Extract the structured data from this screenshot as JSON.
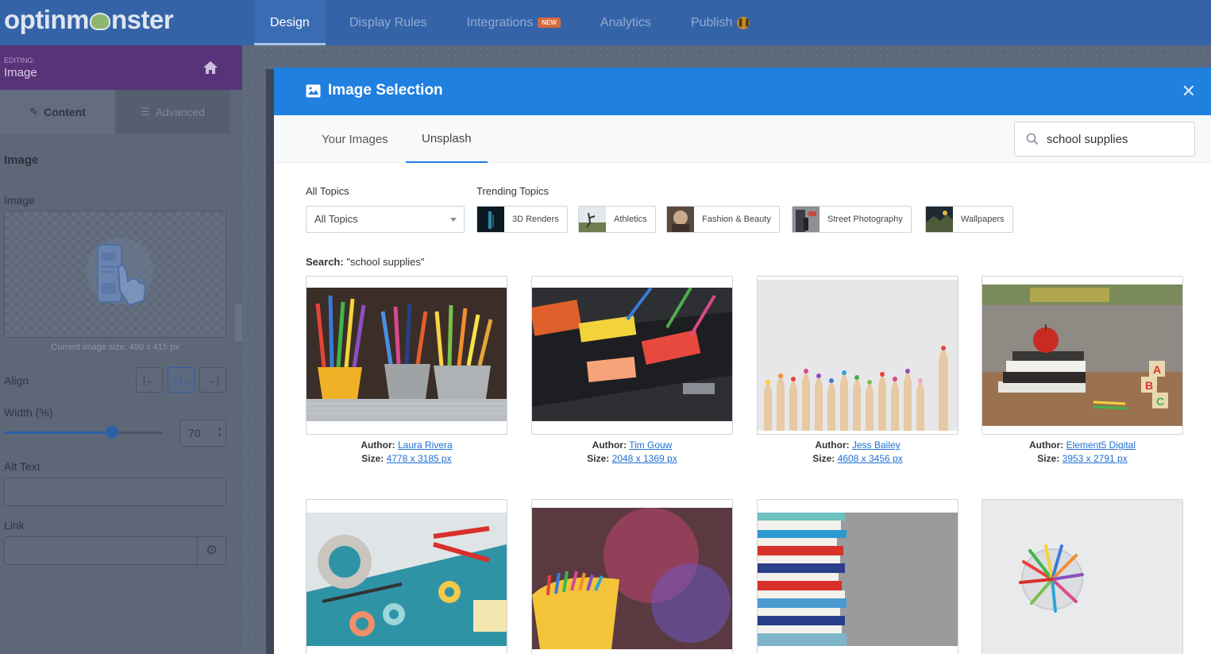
{
  "app": {
    "logo_text_left": "optinm",
    "logo_text_right": "nster",
    "nav": [
      {
        "label": "Design"
      },
      {
        "label": "Display Rules"
      },
      {
        "label": "Integrations",
        "badge": "NEW"
      },
      {
        "label": "Analytics"
      },
      {
        "label": "Publish",
        "badge": "!!"
      }
    ]
  },
  "editor": {
    "editing_label": "EDITING:",
    "editing_name": "Image",
    "tabs": [
      {
        "label": "Content"
      },
      {
        "label": "Advanced"
      }
    ],
    "section_title": "Image",
    "image_label": "Image",
    "current_size": "Current image size: 490 x 415 px",
    "align_label": "Align",
    "width_label": "Width (%)",
    "width_value": "70",
    "width_fraction": 0.68,
    "alt_label": "Alt Text",
    "alt_value": "",
    "link_label": "Link",
    "link_value": ""
  },
  "modal": {
    "title": "Image Selection",
    "tabs": [
      {
        "label": "Your Images"
      },
      {
        "label": "Unsplash"
      }
    ],
    "search_value": "school supplies",
    "all_topics_label": "All Topics",
    "all_topics_selected": "All Topics",
    "trending_label": "Trending Topics",
    "trending": [
      {
        "label": "3D Renders"
      },
      {
        "label": "Athletics"
      },
      {
        "label": "Fashion & Beauty"
      },
      {
        "label": "Street Photography"
      },
      {
        "label": "Wallpapers"
      }
    ],
    "search_prefix": "Search:",
    "search_query": "\"school supplies\"",
    "author_label": "Author:",
    "size_label": "Size:",
    "results": [
      {
        "author": "Laura Rivera",
        "size": "4778 x 3185 px"
      },
      {
        "author": "Tim Gouw",
        "size": "2048 x 1369 px"
      },
      {
        "author": "Jess Bailey",
        "size": "4608 x 3456 px"
      },
      {
        "author": "Element5 Digital",
        "size": "3953 x 2791 px"
      },
      {
        "author": "",
        "size": ""
      },
      {
        "author": "",
        "size": ""
      },
      {
        "author": "",
        "size": ""
      },
      {
        "author": "",
        "size": ""
      }
    ]
  },
  "colors": {
    "topbar": "#3463a8",
    "modal_header": "#1f80e0",
    "link": "#1f6fd0",
    "editing_bar": "#58337a"
  }
}
